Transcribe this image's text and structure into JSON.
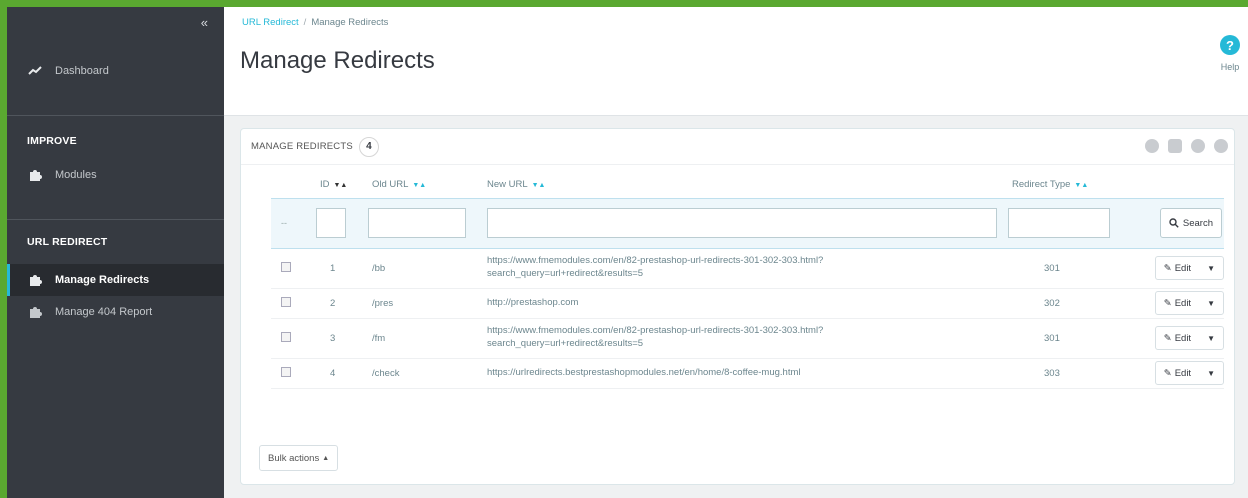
{
  "sidebar": {
    "collapse_icon": "«",
    "dashboard": "Dashboard",
    "section_improve": "IMPROVE",
    "modules": "Modules",
    "section_url_redirect": "URL REDIRECT",
    "manage_redirects": "Manage Redirects",
    "manage_404": "Manage 404 Report"
  },
  "header": {
    "breadcrumb_parent": "URL Redirect",
    "breadcrumb_sep": "/",
    "breadcrumb_current": "Manage Redirects",
    "title": "Manage Redirects",
    "help_icon": "?",
    "help_label": "Help"
  },
  "panel": {
    "title": "MANAGE REDIRECTS",
    "count": "4",
    "columns": {
      "id": "ID",
      "old_url": "Old URL",
      "new_url": "New URL",
      "redirect_type": "Redirect Type"
    },
    "filter_dash": "--",
    "search_label": "Search",
    "edit_label": "Edit",
    "bulk_label": "Bulk actions",
    "rows": [
      {
        "id": "1",
        "old": "/bb",
        "new1": "https://www.fmemodules.com/en/82-prestashop-url-redirects-301-302-303.html?",
        "new2": "search_query=url+redirect&results=5",
        "type": "301"
      },
      {
        "id": "2",
        "old": "/pres",
        "new1": "http://prestashop.com",
        "new2": "",
        "type": "302"
      },
      {
        "id": "3",
        "old": "/fm",
        "new1": "https://www.fmemodules.com/en/82-prestashop-url-redirects-301-302-303.html?",
        "new2": "search_query=url+redirect&results=5",
        "type": "301"
      },
      {
        "id": "4",
        "old": "/check",
        "new1": "https://urlredirects.bestprestashopmodules.net/en/home/8-coffee-mug.html",
        "new2": "",
        "type": "303"
      }
    ]
  },
  "colors": {
    "accent": "#25b9d7",
    "sidebar_bg": "#363a41",
    "frame_green": "#5aa830"
  }
}
